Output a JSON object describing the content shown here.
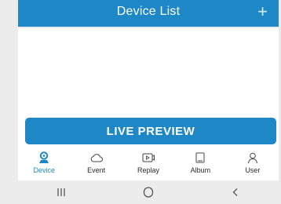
{
  "header": {
    "title": "Device List",
    "add_icon": "plus-icon"
  },
  "main": {
    "live_preview_label": "LIVE PREVIEW"
  },
  "tabs": [
    {
      "label": "Device",
      "icon": "device-camera-icon",
      "active": true
    },
    {
      "label": "Event",
      "icon": "cloud-icon",
      "active": false
    },
    {
      "label": "Replay",
      "icon": "replay-icon",
      "active": false
    },
    {
      "label": "Album",
      "icon": "album-icon",
      "active": false
    },
    {
      "label": "User",
      "icon": "user-icon",
      "active": false
    }
  ],
  "system_nav": {
    "recents_icon": "recents-icon",
    "home_icon": "home-icon",
    "back_icon": "back-icon"
  },
  "colors": {
    "accent": "#1e88c6",
    "background": "#ececec",
    "surface": "#ffffff"
  }
}
